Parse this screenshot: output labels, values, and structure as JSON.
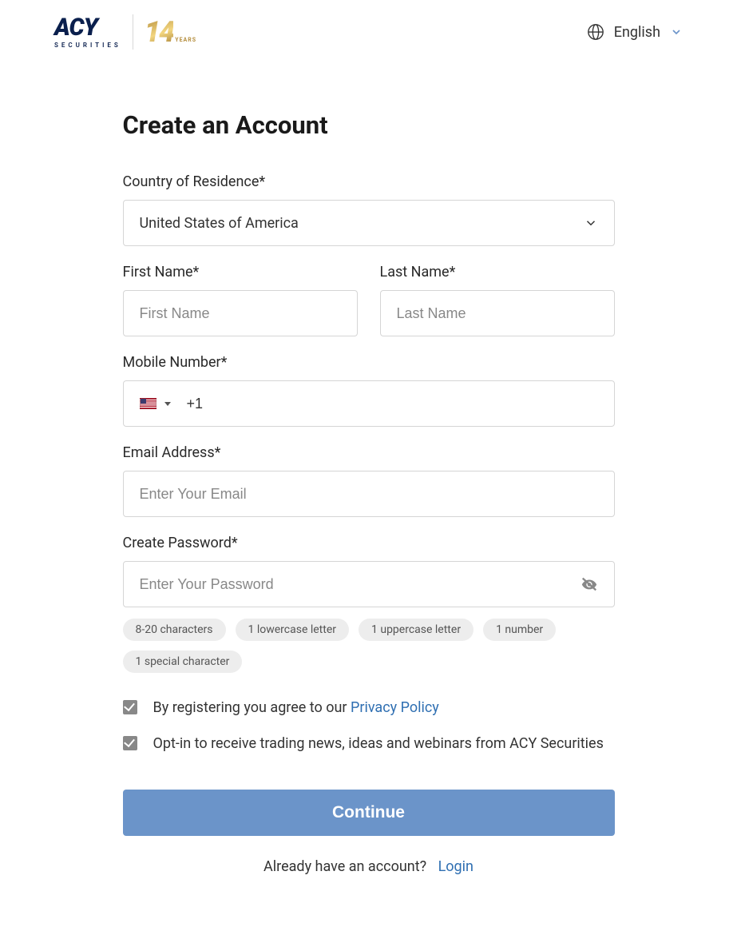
{
  "header": {
    "logo_main": "ACY",
    "logo_sub": "SECURITIES",
    "logo_badge_num": "14",
    "logo_badge_years": "YEARS",
    "language": "English"
  },
  "title": "Create an Account",
  "fields": {
    "country": {
      "label": "Country of Residence*",
      "value": "United States of America"
    },
    "first_name": {
      "label": "First Name*",
      "placeholder": "First Name"
    },
    "last_name": {
      "label": "Last Name*",
      "placeholder": "Last Name"
    },
    "mobile": {
      "label": "Mobile Number*",
      "prefix": "+1"
    },
    "email": {
      "label": "Email Address*",
      "placeholder": "Enter Your Email"
    },
    "password": {
      "label": "Create Password*",
      "placeholder": "Enter Your Password",
      "rules": [
        "8-20 characters",
        "1 lowercase letter",
        "1 uppercase letter",
        "1 number",
        "1 special character"
      ]
    }
  },
  "consent": {
    "terms_pre": "By registering you agree to our ",
    "terms_link": "Privacy Policy",
    "optin": "Opt-in to receive trading news, ideas and webinars from ACY Securities"
  },
  "button": "Continue",
  "footer": {
    "text": "Already have an account?",
    "link": "Login"
  }
}
